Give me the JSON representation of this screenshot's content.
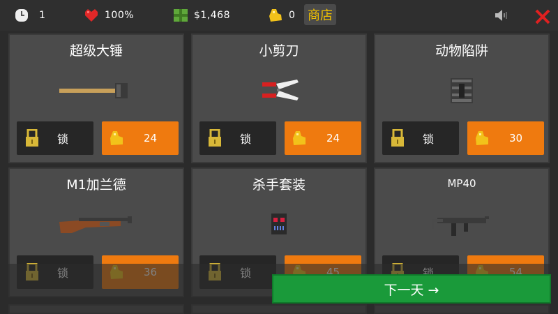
{
  "hud": {
    "days": "1",
    "health": "100%",
    "money": "$1,468",
    "gold": "0",
    "shop_label": "商店"
  },
  "cards": [
    {
      "title": "超级大锤",
      "lock_label": "锁",
      "price": "24",
      "art": "sledgehammer"
    },
    {
      "title": "小剪刀",
      "lock_label": "锁",
      "price": "24",
      "art": "scissors"
    },
    {
      "title": "动物陷阱",
      "lock_label": "锁",
      "price": "30",
      "art": "animal-trap"
    },
    {
      "title": "M1加兰德",
      "lock_label": "锁",
      "price": "36",
      "art": "m1-garand-rifle"
    },
    {
      "title": "杀手套装",
      "lock_label": "锁",
      "price": "45",
      "art": "killer-mask"
    },
    {
      "title": "MP40",
      "lock_label": "锁",
      "price": "54",
      "art": "mp40-smg"
    }
  ],
  "next_day_label": "下一天 →",
  "colors": {
    "buy": "#ef7a0f",
    "next": "#1a9a3a",
    "shop_text": "#f0c000",
    "close": "#e02020"
  }
}
